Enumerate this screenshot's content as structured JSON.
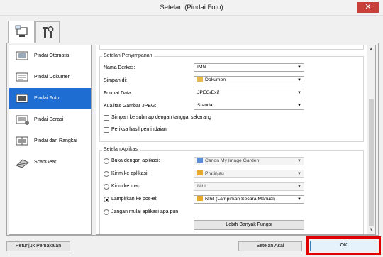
{
  "window": {
    "title": "Setelan (Pindai Foto)",
    "close": "✕"
  },
  "tabs": [
    {
      "name": "scan-settings-tab"
    },
    {
      "name": "general-settings-tab"
    }
  ],
  "sidebar": {
    "items": [
      {
        "label": "Pindai Otomatis"
      },
      {
        "label": "Pindai Dokumen"
      },
      {
        "label": "Pindai Foto"
      },
      {
        "label": "Pindai Serasi"
      },
      {
        "label": "Pindai dan Rangkai"
      },
      {
        "label": "ScanGear"
      }
    ]
  },
  "save_settings": {
    "group_label": "Setelan Penyimpanan",
    "file_name_label": "Nama Berkas:",
    "file_name_value": "IMG",
    "save_in_label": "Simpan di:",
    "save_in_value": "Dokumen",
    "data_format_label": "Format Data:",
    "data_format_value": "JPEG/Exif",
    "jpeg_quality_label": "Kualitas Gambar JPEG:",
    "jpeg_quality_value": "Standar",
    "subfolder_checkbox": "Simpan ke submap dengan tanggal sekarang",
    "check_results_checkbox": "Periksa hasil pemindaian"
  },
  "app_settings": {
    "group_label": "Setelan Aplikasi",
    "open_with_label": "Buka dengan aplikasi:",
    "open_with_value": "Canon My Image Garden",
    "send_to_app_label": "Kirim ke aplikasi:",
    "send_to_app_value": "Pratinjau",
    "send_to_folder_label": "Kirim ke map:",
    "send_to_folder_value": "Nihil",
    "attach_email_label": "Lampirkan ke pos-el:",
    "attach_email_value": "Nihil (Lampirkan Secara Manual)",
    "no_app_label": "Jangan mulai aplikasi apa pun",
    "more_functions_button": "Lebih Banyak Fungsi"
  },
  "footer": {
    "instructions_button": "Petunjuk Pemakaian",
    "defaults_button": "Setelan Asal",
    "ok_button": "OK"
  },
  "colors": {
    "accent": "#1e6dd3",
    "highlight": "#e00000"
  }
}
